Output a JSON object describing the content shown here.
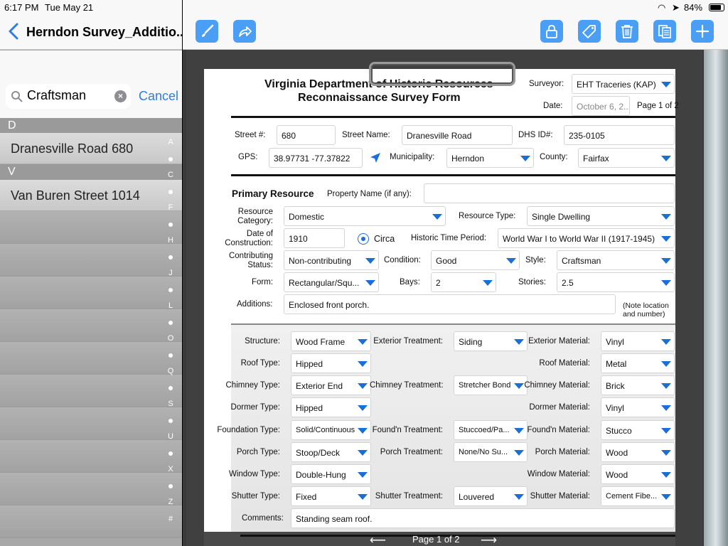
{
  "status": {
    "time": "6:17 PM",
    "date": "Tue May 21",
    "battery": "84%"
  },
  "sidebar": {
    "title": "Herndon Survey_Additio...",
    "search_value": "Craftsman",
    "cancel_label": "Cancel",
    "sections": [
      {
        "header": "D",
        "items": [
          "Dranesville Road 680"
        ]
      },
      {
        "header": "V",
        "items": [
          "Van Buren Street 1014"
        ]
      }
    ],
    "index": [
      "A",
      "C",
      "F",
      "H",
      "J",
      "L",
      "O",
      "Q",
      "S",
      "U",
      "X",
      "Z",
      "#"
    ]
  },
  "toolbar": {
    "left_icons": [
      "brush-icon",
      "share-icon"
    ],
    "right_icons": [
      "lock-icon",
      "tag-icon",
      "trash-icon",
      "copy-icon",
      "plus-icon"
    ]
  },
  "form": {
    "title1": "Virginia Department of Historic Resources",
    "title2": "Reconnaissance Survey Form",
    "surveyor_label": "Surveyor:",
    "surveyor": "EHT Traceries (KAP)",
    "date_label": "Date:",
    "date": "October 6, 2...",
    "page_text": "Page 1 of 2",
    "street_no_label": "Street #:",
    "street_no": "680",
    "street_name_label": "Street Name:",
    "street_name": "Dranesville Road",
    "dhs_label": "DHS ID#:",
    "dhs": "235-0105",
    "gps_label": "GPS:",
    "gps": "38.97731 -77.37822",
    "municipality_label": "Municipality:",
    "municipality": "Herndon",
    "county_label": "County:",
    "county": "Fairfax",
    "primary_resource": "Primary Resource",
    "property_name_label": "Property Name (if any):",
    "property_name": "",
    "resource_category_label": "Resource Category:",
    "resource_category": "Domestic",
    "resource_type_label": "Resource Type:",
    "resource_type": "Single Dwelling",
    "date_construction_label": "Date of Construction:",
    "date_construction": "1910",
    "circa_label": "Circa",
    "historic_period_label": "Historic Time Period:",
    "historic_period": "World War I to World War II (1917-1945)",
    "contributing_label": "Contributing Status:",
    "contributing": "Non-contributing",
    "condition_label": "Condition:",
    "condition": "Good",
    "style_label": "Style:",
    "style": "Craftsman",
    "form_label": "Form:",
    "form": "Rectangular/Squ...",
    "bays_label": "Bays:",
    "bays": "2",
    "stories_label": "Stories:",
    "stories": "2.5",
    "additions_label": "Additions:",
    "additions": "Enclosed front porch.",
    "note": "(Note location and number)",
    "rows": [
      {
        "l1": "Structure:",
        "v1": "Wood Frame",
        "l2": "Exterior Treatment:",
        "v2": "Siding",
        "l3": "Exterior Material:",
        "v3": "Vinyl"
      },
      {
        "l1": "Roof Type:",
        "v1": "Hipped",
        "l2": "",
        "v2": "",
        "l3": "Roof Material:",
        "v3": "Metal"
      },
      {
        "l1": "Chimney Type:",
        "v1": "Exterior End",
        "l2": "Chimney Treatment:",
        "v2": "Stretcher Bond",
        "l3": "Chimney Material:",
        "v3": "Brick"
      },
      {
        "l1": "Dormer Type:",
        "v1": "Hipped",
        "l2": "",
        "v2": "",
        "l3": "Dormer Material:",
        "v3": "Vinyl"
      },
      {
        "l1": "Foundation Type:",
        "v1": "Solid/Continuous",
        "l2": "Found'n Treatment:",
        "v2": "Stuccoed/Pa...",
        "l3": "Found'n Material:",
        "v3": "Stucco"
      },
      {
        "l1": "Porch Type:",
        "v1": "Stoop/Deck",
        "l2": "Porch Treatment:",
        "v2": "None/No Su...",
        "l3": "Porch Material:",
        "v3": "Wood"
      },
      {
        "l1": "Window Type:",
        "v1": "Double-Hung",
        "l2": "",
        "v2": "",
        "l3": "Window Material:",
        "v3": "Wood"
      },
      {
        "l1": "Shutter Type:",
        "v1": "Fixed",
        "l2": "Shutter Treatment:",
        "v2": "Louvered",
        "l3": "Shutter Material:",
        "v3": "Cement Fibe..."
      }
    ],
    "comments_label": "Comments:",
    "comments": "Standing seam roof.",
    "page_indicator": "Page 1 of 2"
  }
}
